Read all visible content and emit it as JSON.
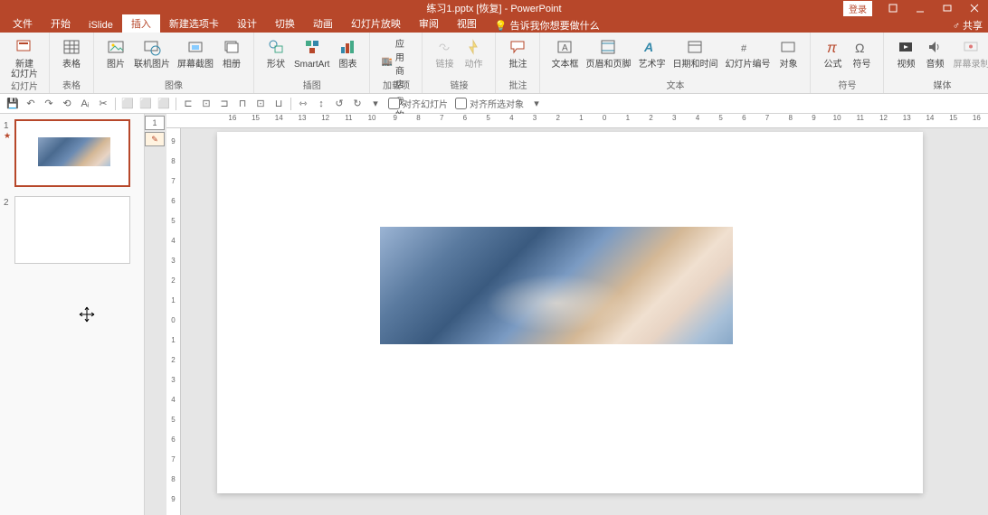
{
  "titlebar": {
    "title": "练习1.pptx [恢复] - PowerPoint",
    "login": "登录"
  },
  "tabs": [
    "文件",
    "开始",
    "iSlide",
    "插入",
    "新建选项卡",
    "设计",
    "切换",
    "动画",
    "幻灯片放映",
    "审阅",
    "视图"
  ],
  "active_tab": 3,
  "tell_me": "告诉我你想要做什么",
  "share": "共享",
  "ribbon": {
    "g1": {
      "label": "幻灯片",
      "new_slide": "新建\n幻灯片"
    },
    "g2": {
      "label": "表格",
      "table": "表格"
    },
    "g3": {
      "label": "图像",
      "pic": "图片",
      "online": "联机图片",
      "screenshot": "屏幕截图",
      "album": "相册"
    },
    "g4": {
      "label": "插图",
      "shapes": "形状",
      "smartart": "SmartArt",
      "chart": "图表"
    },
    "g5": {
      "label": "加载项",
      "store": "应用商店",
      "my": "我的加载项"
    },
    "g6": {
      "label": "链接",
      "link": "链接",
      "action": "动作"
    },
    "g7": {
      "label": "批注",
      "comment": "批注"
    },
    "g8": {
      "label": "文本",
      "textbox": "文本框",
      "header": "页眉和页脚",
      "wordart": "艺术字",
      "date": "日期和时间",
      "slidenum": "幻灯片编号",
      "object": "对象"
    },
    "g9": {
      "label": "符号",
      "eq": "公式",
      "sym": "符号"
    },
    "g10": {
      "label": "媒体",
      "video": "视频",
      "audio": "音频",
      "screen": "屏幕录制"
    }
  },
  "qat": {
    "align_slide": "对齐幻灯片",
    "align_selected": "对齐所选对象"
  },
  "hruler": [
    "16",
    "15",
    "14",
    "13",
    "12",
    "11",
    "10",
    "9",
    "8",
    "7",
    "6",
    "5",
    "4",
    "3",
    "2",
    "1",
    "0",
    "1",
    "2",
    "3",
    "4",
    "5",
    "6",
    "7",
    "8",
    "9",
    "10",
    "11",
    "12",
    "13",
    "14",
    "15",
    "16"
  ],
  "vruler": [
    "9",
    "8",
    "7",
    "6",
    "5",
    "4",
    "3",
    "2",
    "1",
    "0",
    "1",
    "2",
    "3",
    "4",
    "5",
    "6",
    "7",
    "8",
    "9"
  ],
  "slides": [
    1,
    2
  ],
  "tag1": "1"
}
